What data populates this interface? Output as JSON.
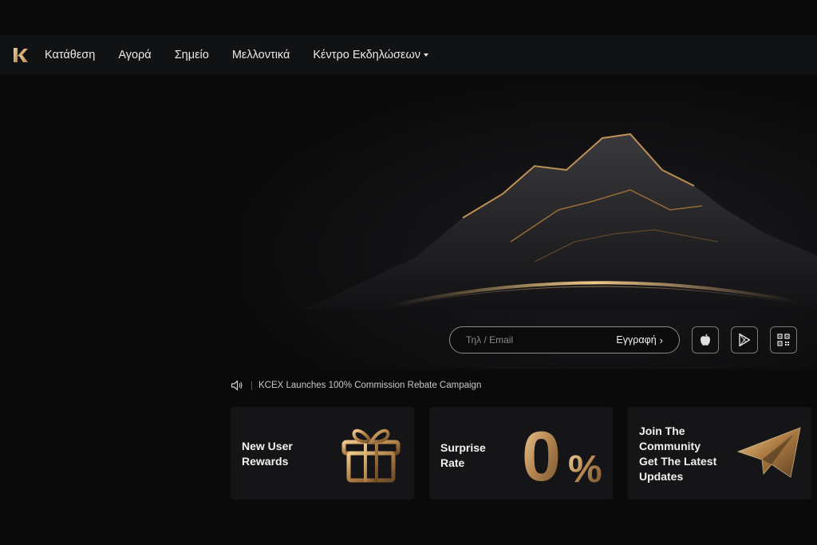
{
  "nav": {
    "items": [
      {
        "label": "Κατάθεση"
      },
      {
        "label": "Αγορά"
      },
      {
        "label": "Σημείο"
      },
      {
        "label": "Μελλοντικά"
      },
      {
        "label": "Κέντρο Εκδηλώσεων"
      }
    ]
  },
  "signup": {
    "placeholder": "Τηλ / Email",
    "button_label": "Εγγραφή",
    "button_chevron": "›"
  },
  "apps": {
    "apple_icon": "apple-icon",
    "play_icon": "google-play-icon",
    "qr_icon": "qr-code-icon"
  },
  "announcement": {
    "text": "KCEX Launches 100% Commission Rebate Campaign"
  },
  "cards": [
    {
      "line1": "New User",
      "line2": "Rewards"
    },
    {
      "line1": "Surprise",
      "line2": "Rate",
      "graphic_number": "0",
      "graphic_percent": "%"
    },
    {
      "line1": "Join The",
      "line2": "Community",
      "line3": "Get The Latest",
      "line4": "Updates"
    }
  ],
  "colors": {
    "gold": "#c9a06a",
    "gold_light": "#f0c98a",
    "background": "#0b0b0c",
    "card": "#151517"
  }
}
